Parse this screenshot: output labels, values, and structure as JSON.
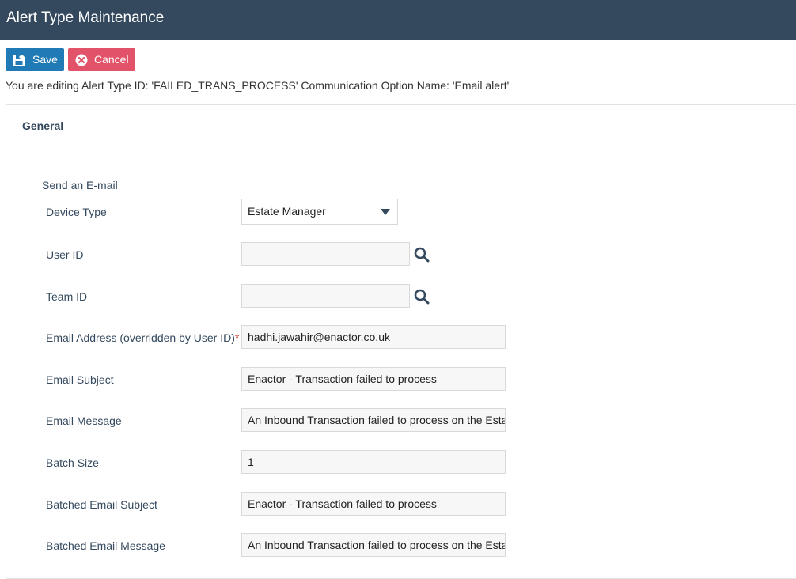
{
  "window": {
    "title": "Alert Type Maintenance"
  },
  "toolbar": {
    "save_label": "Save",
    "cancel_label": "Cancel"
  },
  "info_text": "You are editing Alert Type ID: 'FAILED_TRANS_PROCESS' Communication Option Name: 'Email alert'",
  "section": {
    "title": "General",
    "subtitle": "Send an E-mail"
  },
  "form": {
    "device_type": {
      "label": "Device Type",
      "value": "Estate Manager"
    },
    "user_id": {
      "label": "User ID",
      "value": ""
    },
    "team_id": {
      "label": "Team ID",
      "value": ""
    },
    "email_address": {
      "label": "Email Address (overridden by User ID)",
      "required_mark": "*",
      "value": "hadhi.jawahir@enactor.co.uk"
    },
    "email_subject": {
      "label": "Email Subject",
      "value": "Enactor - Transaction failed to process"
    },
    "email_message": {
      "label": "Email Message",
      "value": "An Inbound Transaction failed to process on the Estate"
    },
    "batch_size": {
      "label": "Batch Size",
      "value": "1"
    },
    "batched_email_subject": {
      "label": "Batched Email Subject",
      "value": "Enactor - Transaction failed to process"
    },
    "batched_email_message": {
      "label": "Batched Email Message",
      "value": "An Inbound Transaction failed to process on the Estate"
    }
  },
  "icons": {
    "save": "floppy-disk-icon",
    "cancel": "x-circle-icon",
    "lookup": "search-icon",
    "dropdown": "caret-down-icon"
  },
  "colors": {
    "titlebar": "#34495e",
    "save_button": "#1f7ab5",
    "cancel_button": "#e2536a",
    "label_text": "#34495e",
    "required": "#d9534f"
  }
}
